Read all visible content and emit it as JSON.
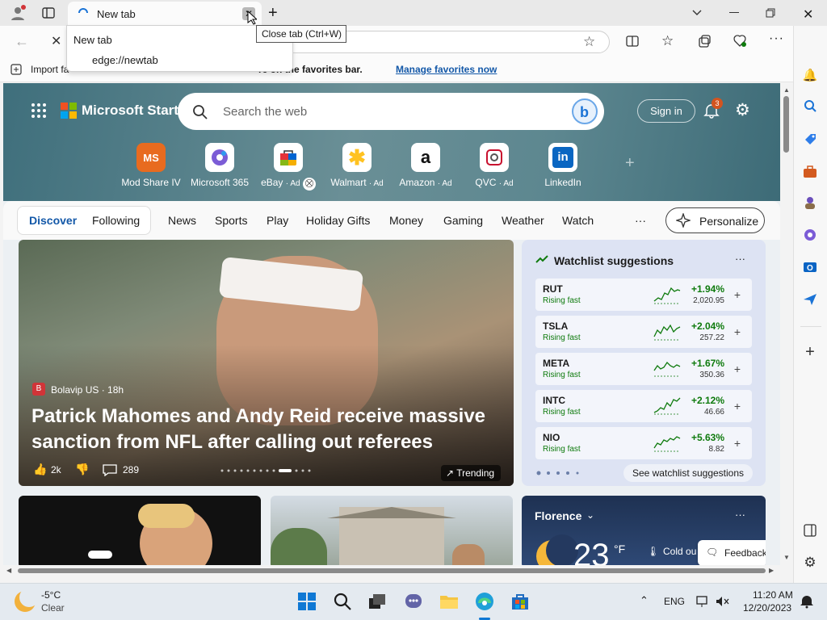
{
  "browser": {
    "tab_title": "New tab",
    "close_tab_tooltip": "Close tab (Ctrl+W)",
    "dropdown_title": "New tab",
    "dropdown_url": "edge://newtab",
    "favorites_bar": {
      "import_label": "Import fa",
      "message": "re on the favorites bar.",
      "manage_link": "Manage favorites now"
    }
  },
  "start": {
    "logo_text": "Microsoft Start",
    "search_placeholder": "Search the web",
    "sign_in": "Sign in",
    "notification_count": "3",
    "tiles": [
      {
        "label": "Mod Share IV",
        "icon": "MS",
        "color": "#c0392b"
      },
      {
        "label": "Microsoft 365",
        "icon": "365",
        "color": "#7b5cd6"
      },
      {
        "label": "eBay",
        "ad": "· Ad",
        "icon": "eBay",
        "color": "#e53238"
      },
      {
        "label": "Walmart",
        "ad": "· Ad",
        "icon": "*",
        "color": "#0071ce"
      },
      {
        "label": "Amazon",
        "ad": "· Ad",
        "icon": "a",
        "color": "#111"
      },
      {
        "label": "QVC",
        "ad": "· Ad",
        "icon": "Q",
        "color": "#c8102e"
      },
      {
        "label": "LinkedIn",
        "icon": "in",
        "color": "#0a66c2"
      }
    ],
    "nav": {
      "discover": "Discover",
      "following": "Following",
      "items": [
        "News",
        "Sports",
        "Play",
        "Holiday Gifts",
        "Money",
        "Gaming",
        "Weather",
        "Watch"
      ],
      "more": "···",
      "personalize": "Personalize"
    },
    "story": {
      "source": "Bolavip US · 18h",
      "headline_line1": "Patrick Mahomes and Andy Reid receive massive",
      "headline_line2": "sanction from NFL after calling out referees",
      "likes": "2k",
      "comments": "289",
      "trending": "Trending"
    },
    "watchlist": {
      "title": "Watchlist suggestions",
      "items": [
        {
          "symbol": "RUT",
          "status": "Rising fast",
          "change": "+1.94%",
          "price": "2,020.95"
        },
        {
          "symbol": "TSLA",
          "status": "Rising fast",
          "change": "+2.04%",
          "price": "257.22"
        },
        {
          "symbol": "META",
          "status": "Rising fast",
          "change": "+1.67%",
          "price": "350.36"
        },
        {
          "symbol": "INTC",
          "status": "Rising fast",
          "change": "+2.12%",
          "price": "46.66"
        },
        {
          "symbol": "NIO",
          "status": "Rising fast",
          "change": "+5.63%",
          "price": "8.82"
        }
      ],
      "see_more": "See watchlist suggestions"
    },
    "weather_card": {
      "city": "Florence",
      "temp": "23",
      "unit": "°F",
      "condition": "Cold ou"
    },
    "feedback": "Feedback"
  },
  "taskbar": {
    "weather_temp": "-5°C",
    "weather_desc": "Clear",
    "lang": "ENG",
    "time": "11:20 AM",
    "date": "12/20/2023"
  }
}
